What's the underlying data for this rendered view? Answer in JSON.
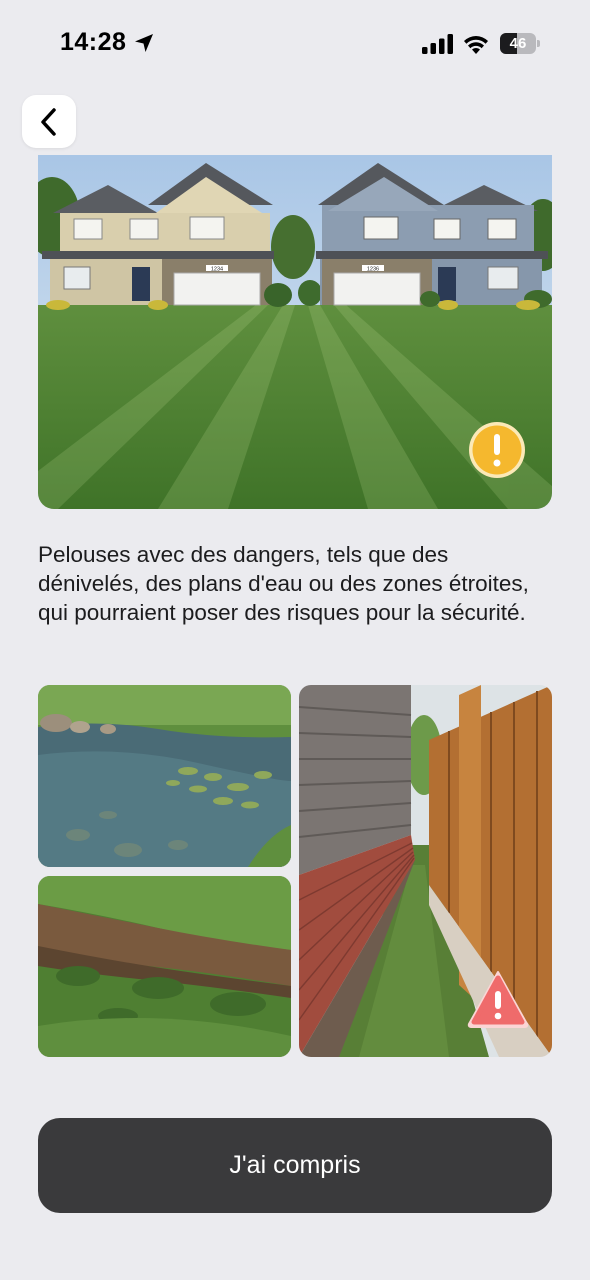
{
  "status_bar": {
    "time": "14:28",
    "battery_level": "46",
    "battery_fraction": 0.46,
    "icons": [
      "location-arrow-icon",
      "cell-signal-icon",
      "wifi-icon",
      "battery-icon"
    ]
  },
  "nav": {
    "back_icon": "chevron-left-icon"
  },
  "hero": {
    "house_numbers": [
      "1234",
      "1236"
    ],
    "badge_icon": "exclamation-icon",
    "badge_color": "#f5b82e"
  },
  "description": "Pelouses avec des dangers, tels que des dénivelés, des plans d'eau ou des zones étroites, qui pourraient poser des risques pour la sécurité.",
  "gallery": {
    "badge_icon": "warning-triangle-icon",
    "badge_color": "#ef6b6b"
  },
  "cta": {
    "label": "J'ai compris"
  },
  "colors": {
    "background": "#ebebef",
    "button": "#3a3a3c",
    "button_text": "#ffffff"
  }
}
